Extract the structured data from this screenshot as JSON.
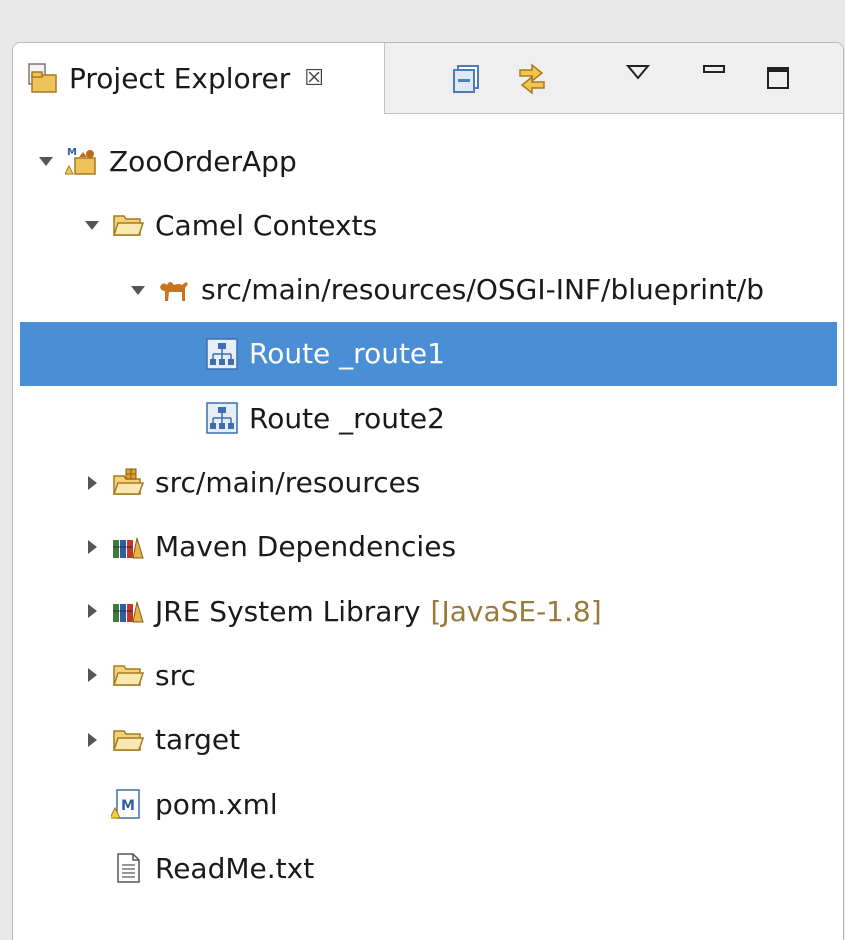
{
  "view": {
    "tab_label": "Project Explorer",
    "tab_close_glyph": "☒",
    "toolbar_icons": [
      "collapse-all-icon",
      "link-with-editor-icon",
      "view-menu-icon",
      "minimize-icon",
      "maximize-icon"
    ]
  },
  "tree": [
    {
      "label": "ZooOrderApp",
      "depth": 0,
      "expanded": true,
      "icon": "maven-camel-project-icon"
    },
    {
      "label": "Camel Contexts",
      "depth": 1,
      "expanded": true,
      "icon": "open-folder-icon"
    },
    {
      "label": "src/main/resources/OSGI-INF/blueprint/b",
      "depth": 2,
      "expanded": true,
      "icon": "camel-icon"
    },
    {
      "label": "Route _route1",
      "depth": 3,
      "leaf": true,
      "selected": true,
      "icon": "route-icon"
    },
    {
      "label": "Route _route2",
      "depth": 3,
      "leaf": true,
      "icon": "route-icon"
    },
    {
      "label": "src/main/resources",
      "depth": 1,
      "expanded": false,
      "icon": "source-folder-icon"
    },
    {
      "label": "Maven Dependencies",
      "depth": 1,
      "expanded": false,
      "icon": "library-icon"
    },
    {
      "label": "JRE System Library",
      "decoration": "[JavaSE-1.8]",
      "depth": 1,
      "expanded": false,
      "icon": "library-icon"
    },
    {
      "label": "src",
      "depth": 1,
      "expanded": false,
      "icon": "folder-icon"
    },
    {
      "label": "target",
      "depth": 1,
      "expanded": false,
      "icon": "folder-icon"
    },
    {
      "label": "pom.xml",
      "depth": 1,
      "leaf": true,
      "icon": "maven-pom-icon"
    },
    {
      "label": "ReadMe.txt",
      "depth": 1,
      "leaf": true,
      "icon": "text-file-icon"
    }
  ],
  "colors": {
    "selection": "#4a8fd6",
    "decoration": "#9a7a3a",
    "folder": "#e8b24a",
    "route_blue": "#3d6fb0"
  }
}
